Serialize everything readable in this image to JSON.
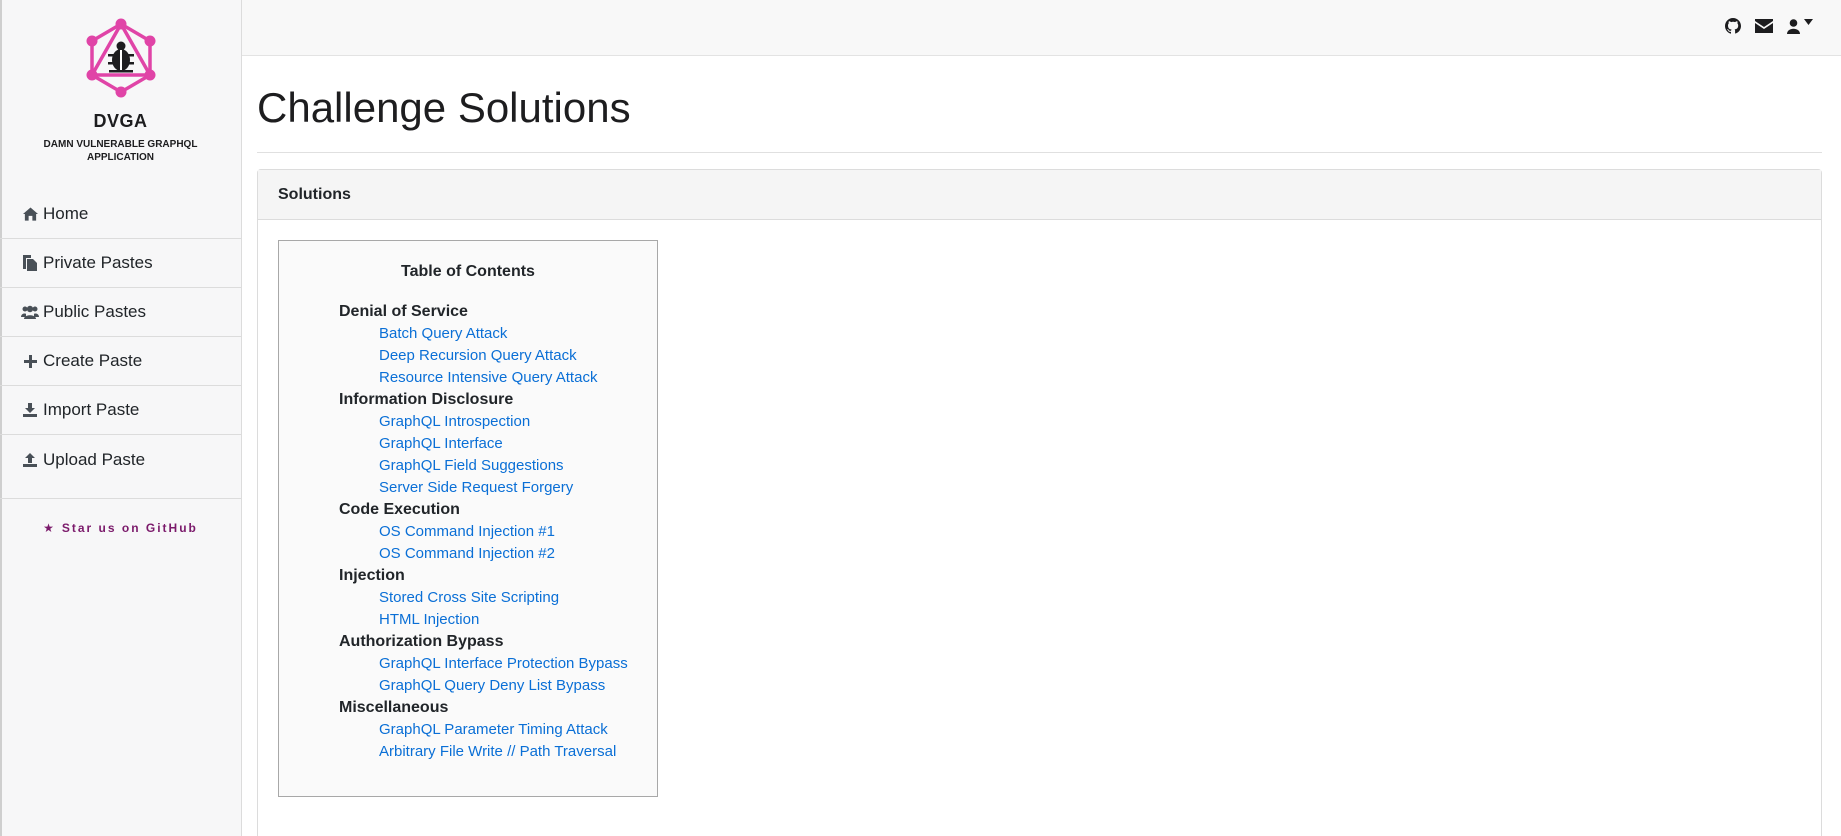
{
  "brand": {
    "name": "DVGA",
    "subtitle": "DAMN VULNERABLE GRAPHQL APPLICATION",
    "logo_color": "#e044a7"
  },
  "sidebar": {
    "items": [
      {
        "label": "Home",
        "icon": "home-icon"
      },
      {
        "label": "Private Pastes",
        "icon": "copy-icon"
      },
      {
        "label": "Public Pastes",
        "icon": "users-icon"
      },
      {
        "label": "Create Paste",
        "icon": "plus-icon"
      },
      {
        "label": "Import Paste",
        "icon": "download-icon"
      },
      {
        "label": "Upload Paste",
        "icon": "upload-icon"
      }
    ],
    "star_label": "Star us on GitHub"
  },
  "topbar": {
    "icons": [
      "github-icon",
      "envelope-icon",
      "user-icon",
      "caret-down-icon"
    ]
  },
  "page": {
    "title": "Challenge Solutions",
    "card_title": "Solutions"
  },
  "toc": {
    "title": "Table of Contents",
    "sections": [
      {
        "heading": "Denial of Service",
        "links": [
          "Batch Query Attack",
          "Deep Recursion Query Attack",
          "Resource Intensive Query Attack"
        ]
      },
      {
        "heading": "Information Disclosure",
        "links": [
          "GraphQL Introspection",
          "GraphQL Interface",
          "GraphQL Field Suggestions",
          "Server Side Request Forgery"
        ]
      },
      {
        "heading": "Code Execution",
        "links": [
          "OS Command Injection #1",
          "OS Command Injection #2"
        ]
      },
      {
        "heading": "Injection",
        "links": [
          "Stored Cross Site Scripting",
          "HTML Injection"
        ]
      },
      {
        "heading": "Authorization Bypass",
        "links": [
          "GraphQL Interface Protection Bypass",
          "GraphQL Query Deny List Bypass"
        ]
      },
      {
        "heading": "Miscellaneous",
        "links": [
          "GraphQL Parameter Timing Attack",
          "Arbitrary File Write // Path Traversal"
        ]
      }
    ]
  },
  "colors": {
    "link": "#0a6fd6",
    "star_link": "#7b1a6b"
  }
}
